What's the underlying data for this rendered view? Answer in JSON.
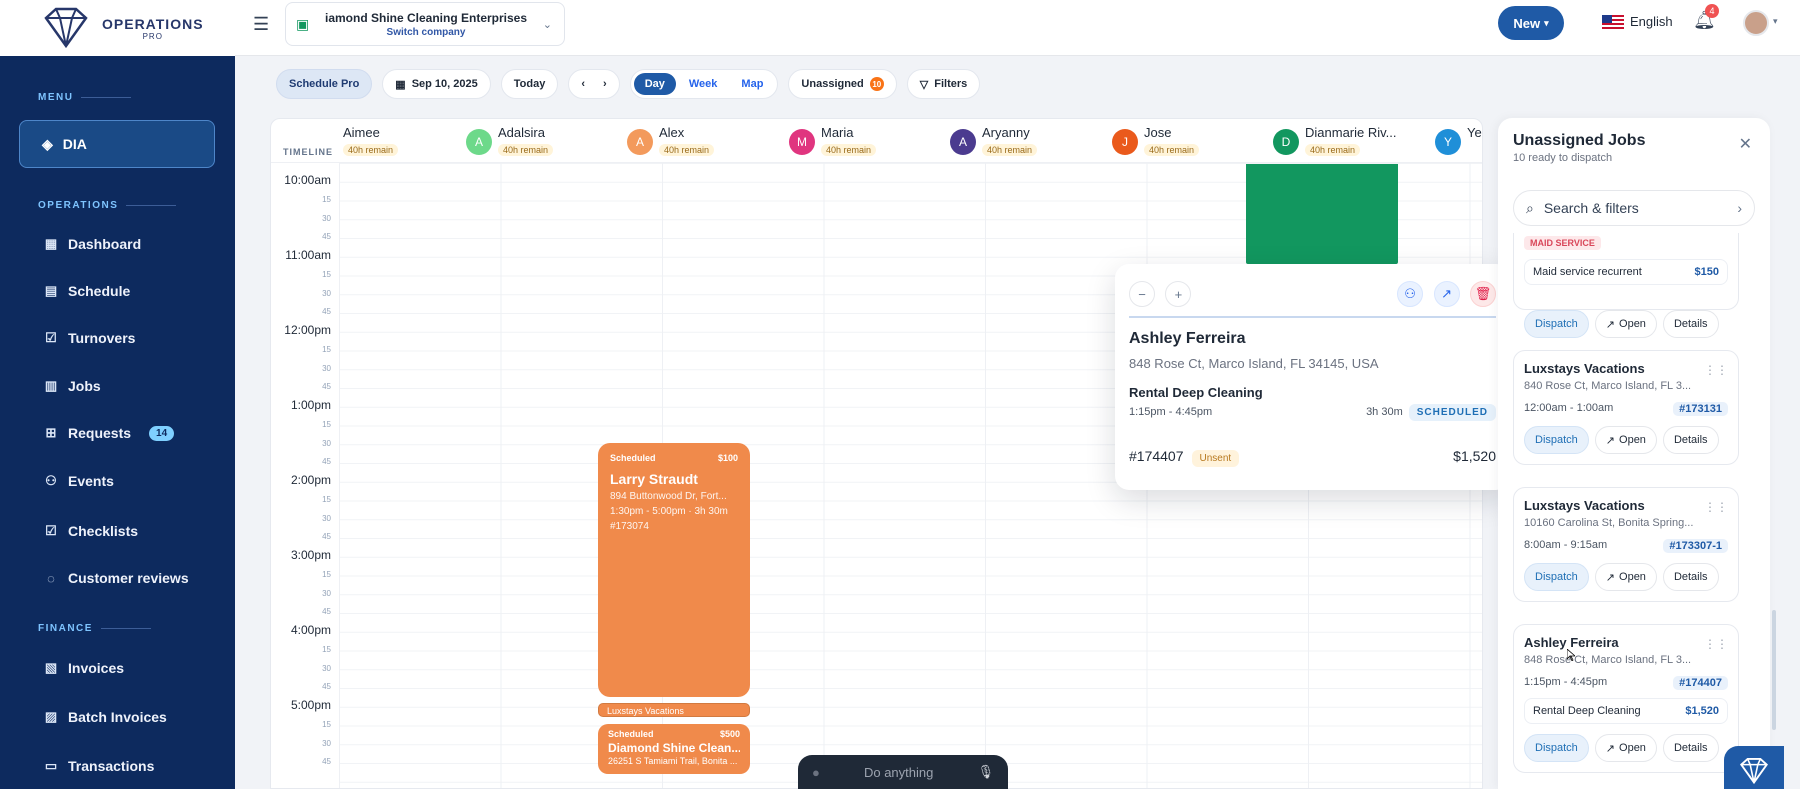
{
  "brand": {
    "name": "OPERATIONS",
    "sub": "PRO"
  },
  "company": {
    "name": "iamond Shine Cleaning Enterprises",
    "switch_label": "Switch company"
  },
  "topbar": {
    "new_label": "New",
    "language": "English",
    "notifications": "4"
  },
  "sidebar": {
    "menu_label": "MENU",
    "current": "DIA",
    "operations_label": "OPERATIONS",
    "operations": [
      {
        "label": "Dashboard",
        "icon": "grid-icon"
      },
      {
        "label": "Schedule",
        "icon": "calendar-icon"
      },
      {
        "label": "Turnovers",
        "icon": "check-calendar-icon"
      },
      {
        "label": "Jobs",
        "icon": "document-icon"
      },
      {
        "label": "Requests",
        "icon": "plus-square-icon",
        "badge": "14"
      },
      {
        "label": "Events",
        "icon": "user-plus-icon"
      },
      {
        "label": "Checklists",
        "icon": "checklist-icon"
      },
      {
        "label": "Customer reviews",
        "icon": "chat-icon"
      }
    ],
    "finance_label": "FINANCE",
    "finance": [
      {
        "label": "Invoices",
        "icon": "invoice-icon"
      },
      {
        "label": "Batch Invoices",
        "icon": "batch-icon"
      },
      {
        "label": "Transactions",
        "icon": "card-icon"
      }
    ]
  },
  "toolbar": {
    "schedule_pro": "Schedule Pro",
    "date": "Sep 10, 2025",
    "today": "Today",
    "views": [
      "Day",
      "Week",
      "Map"
    ],
    "unassigned": "Unassigned",
    "unassigned_count": "10",
    "filters": "Filters"
  },
  "calendar": {
    "timeline_label": "TIMELINE",
    "staff": [
      {
        "name": "Aimee",
        "remain": "40h remain",
        "initial": "",
        "color": ""
      },
      {
        "name": "Adalsira",
        "remain": "40h remain",
        "initial": "A",
        "color": "#6dd98a"
      },
      {
        "name": "Alex",
        "remain": "40h remain",
        "initial": "A",
        "color": "#f39a5c"
      },
      {
        "name": "Maria",
        "remain": "40h remain",
        "initial": "M",
        "color": "#e0357f"
      },
      {
        "name": "Aryanny",
        "remain": "40h remain",
        "initial": "A",
        "color": "#4b3b8f"
      },
      {
        "name": "Jose",
        "remain": "40h remain",
        "initial": "J",
        "color": "#ea5a1c"
      },
      {
        "name": "Dianmarie Riv...",
        "remain": "40h remain",
        "initial": "D",
        "color": "#12975f"
      },
      {
        "name": "Ye",
        "remain": "",
        "initial": "Y",
        "color": "#1f8fd8"
      }
    ],
    "hours": [
      "10:00am",
      "11:00am",
      "12:00pm",
      "1:00pm",
      "2:00pm",
      "3:00pm",
      "4:00pm",
      "5:00pm"
    ],
    "quarters": [
      "15",
      "30",
      "45"
    ],
    "jobs": [
      {
        "status": "Scheduled",
        "price": "$100",
        "title": "Larry Straudt",
        "address": "894 Buttonwood Dr, Fort...",
        "time": "1:30pm - 5:00pm · 3h 30m",
        "id": "#173074"
      },
      {
        "title": "Luxstays Vacations"
      },
      {
        "status": "Scheduled",
        "price": "$500",
        "title": "Diamond Shine Clean...",
        "address": "26251 S Tamiami Trail, Bonita ..."
      }
    ]
  },
  "popup": {
    "name": "Ashley Ferreira",
    "address": "848 Rose Ct, Marco Island, FL 34145, USA",
    "service": "Rental Deep Cleaning",
    "time": "1:15pm - 4:45pm",
    "duration": "3h 30m",
    "status": "SCHEDULED",
    "id": "#174407",
    "invoice_status": "Unsent",
    "total": "$1,520"
  },
  "panel": {
    "title": "Unassigned Jobs",
    "subtitle": "10 ready to dispatch",
    "search_placeholder": "Search & filters",
    "cards": [
      {
        "tag": "MAID SERVICE",
        "service": "Maid service recurrent",
        "price": "$150"
      },
      {
        "title": "Luxstays Vacations",
        "address": "840 Rose Ct, Marco Island, FL 3...",
        "time": "12:00am - 1:00am",
        "id": "#173131"
      },
      {
        "title": "Luxstays Vacations",
        "address": "10160 Carolina St, Bonita Spring...",
        "time": "8:00am - 9:15am",
        "id": "#173307-1"
      },
      {
        "title": "Ashley Ferreira",
        "address": "848 Rose Ct, Marco Island, FL 3...",
        "time": "1:15pm - 4:45pm",
        "id": "#174407",
        "service": "Rental Deep Cleaning",
        "price": "$1,520"
      }
    ],
    "dispatch": "Dispatch",
    "open": "Open",
    "details": "Details"
  },
  "assistant": {
    "placeholder": "Do anything"
  }
}
